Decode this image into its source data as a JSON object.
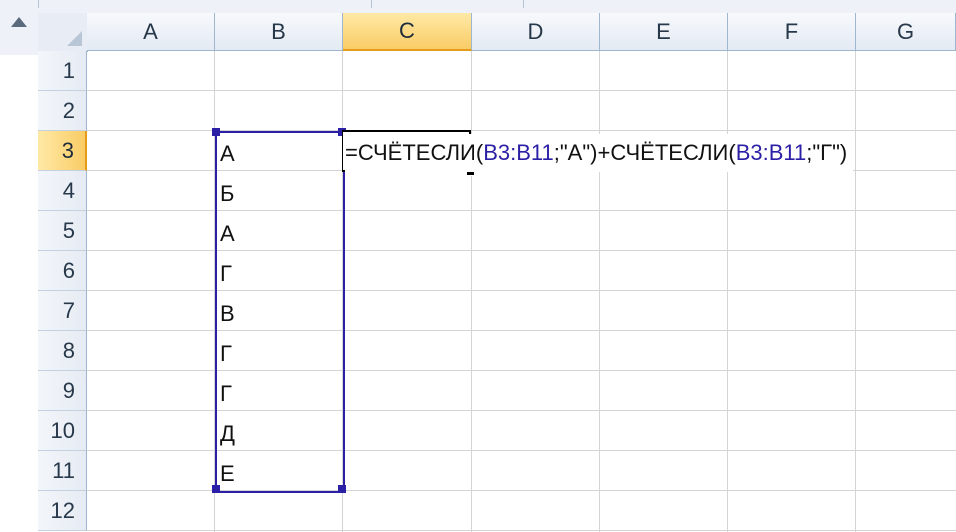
{
  "columns": [
    "A",
    "B",
    "C",
    "D",
    "E",
    "F",
    "G"
  ],
  "active_column": "C",
  "rows": [
    "1",
    "2",
    "3",
    "4",
    "5",
    "6",
    "7",
    "8",
    "9",
    "10",
    "11",
    "12"
  ],
  "active_row": "3",
  "column_b_values": [
    "А",
    "Б",
    "А",
    "Г",
    "В",
    "Г",
    "Г",
    "Д",
    "Е"
  ],
  "formula": {
    "part1": "=СЧЁТЕСЛИ(",
    "ref1": "B3:B11",
    "part2": ";\"А\")+СЧЁТЕСЛИ(",
    "ref2": "B3:B11",
    "part3": ";\"Г\")"
  },
  "colors": {
    "range_highlight": "#2b1fa6",
    "active_header": "#f9cc66",
    "gridline": "#d4d4d4"
  },
  "icons": {
    "scroll_up": "triangle-up-icon",
    "select_all": "select-all-corner-icon"
  }
}
